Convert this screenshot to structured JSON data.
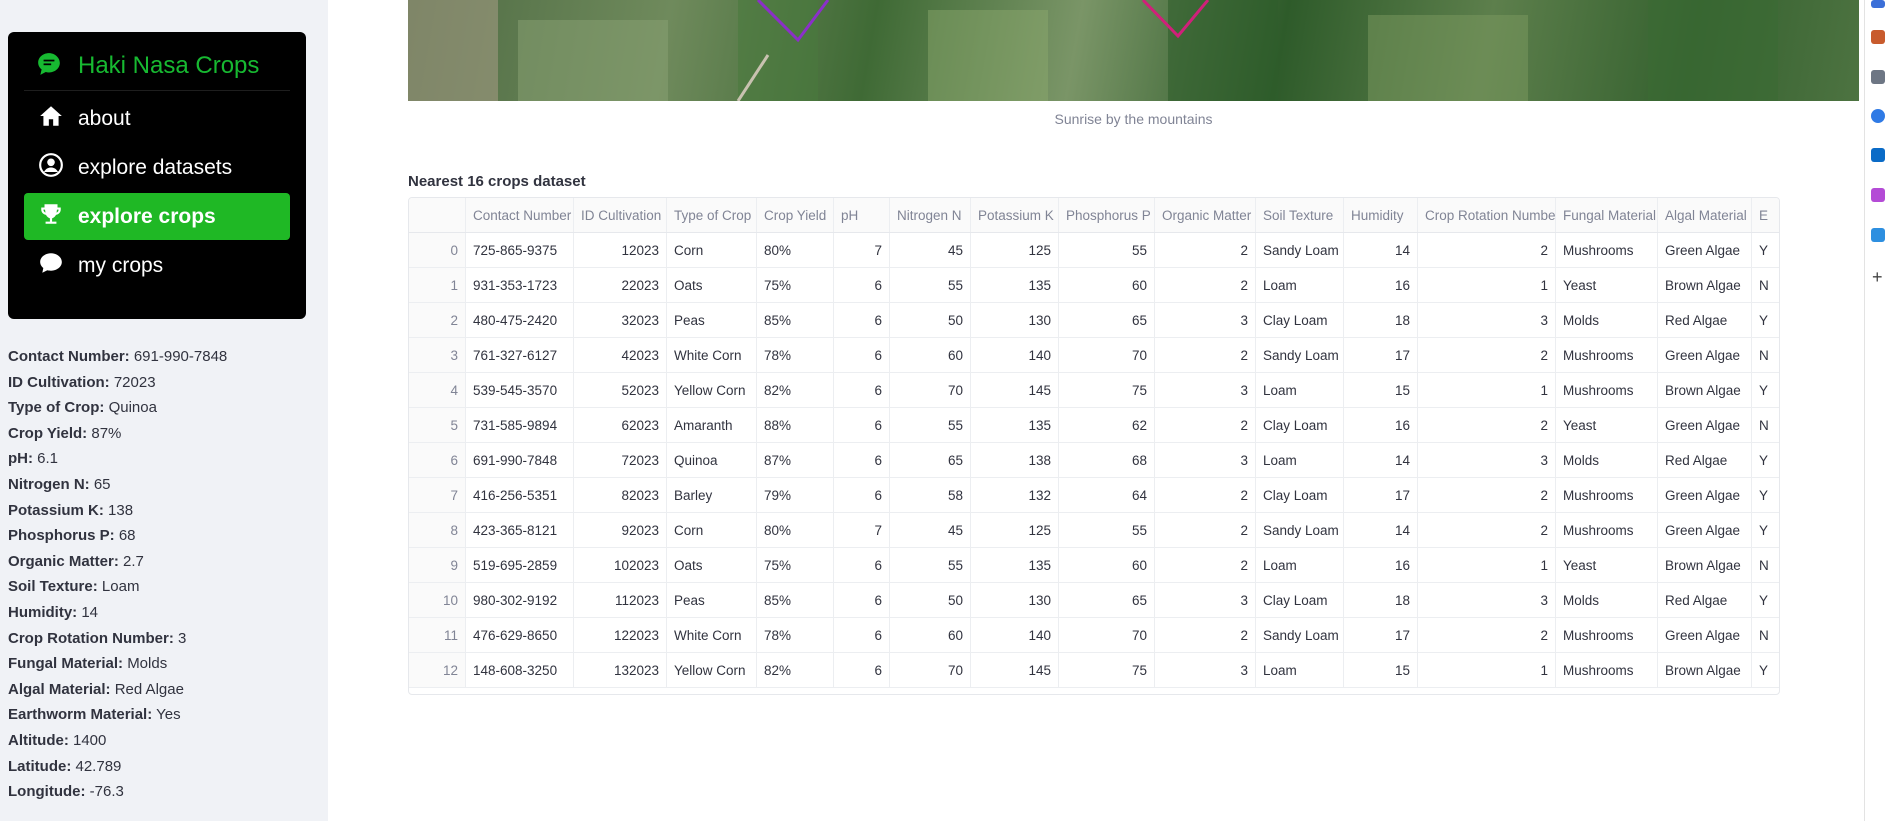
{
  "sidebar": {
    "brand": "Haki Nasa Crops",
    "menu": [
      {
        "label": "about",
        "icon": "house-icon",
        "active": false
      },
      {
        "label": "explore datasets",
        "icon": "person-circle-icon",
        "active": false
      },
      {
        "label": "explore crops",
        "icon": "trophy-icon",
        "active": true
      },
      {
        "label": "my crops",
        "icon": "chat-bubble-icon",
        "active": false
      }
    ],
    "details": [
      {
        "k": "Contact Number:",
        "v": "691-990-7848"
      },
      {
        "k": "ID Cultivation:",
        "v": "72023"
      },
      {
        "k": "Type of Crop:",
        "v": "Quinoa"
      },
      {
        "k": "Crop Yield:",
        "v": "87%"
      },
      {
        "k": "pH:",
        "v": "6.1"
      },
      {
        "k": "Nitrogen N:",
        "v": "65"
      },
      {
        "k": "Potassium K:",
        "v": "138"
      },
      {
        "k": "Phosphorus P:",
        "v": "68"
      },
      {
        "k": "Organic Matter:",
        "v": "2.7"
      },
      {
        "k": "Soil Texture:",
        "v": "Loam"
      },
      {
        "k": "Humidity:",
        "v": "14"
      },
      {
        "k": "Crop Rotation Number:",
        "v": "3"
      },
      {
        "k": "Fungal Material:",
        "v": "Molds"
      },
      {
        "k": "Algal Material:",
        "v": "Red Algae"
      },
      {
        "k": "Earthworm Material:",
        "v": "Yes"
      },
      {
        "k": "Altitude:",
        "v": "1400"
      },
      {
        "k": "Latitude:",
        "v": "42.789"
      },
      {
        "k": "Longitude:",
        "v": "-76.3"
      }
    ]
  },
  "main": {
    "image_caption": "Sunrise by the mountains",
    "table_title": "Nearest 16 crops dataset",
    "columns": [
      "",
      "Contact Number",
      "ID Cultivation",
      "Type of Crop",
      "Crop Yield",
      "pH",
      "Nitrogen N",
      "Potassium K",
      "Phosphorus P",
      "Organic Matter",
      "Soil Texture",
      "Humidity",
      "Crop Rotation Number",
      "Fungal Material",
      "Algal Material",
      "E"
    ],
    "rows": [
      [
        "0",
        "725-865-9375",
        "12023",
        "Corn",
        "80%",
        "7",
        "45",
        "125",
        "55",
        "2",
        "Sandy Loam",
        "14",
        "2",
        "Mushrooms",
        "Green Algae",
        "Y"
      ],
      [
        "1",
        "931-353-1723",
        "22023",
        "Oats",
        "75%",
        "6",
        "55",
        "135",
        "60",
        "2",
        "Loam",
        "16",
        "1",
        "Yeast",
        "Brown Algae",
        "N"
      ],
      [
        "2",
        "480-475-2420",
        "32023",
        "Peas",
        "85%",
        "6",
        "50",
        "130",
        "65",
        "3",
        "Clay Loam",
        "18",
        "3",
        "Molds",
        "Red Algae",
        "Y"
      ],
      [
        "3",
        "761-327-6127",
        "42023",
        "White Corn",
        "78%",
        "6",
        "60",
        "140",
        "70",
        "2",
        "Sandy Loam",
        "17",
        "2",
        "Mushrooms",
        "Green Algae",
        "N"
      ],
      [
        "4",
        "539-545-3570",
        "52023",
        "Yellow Corn",
        "82%",
        "6",
        "70",
        "145",
        "75",
        "3",
        "Loam",
        "15",
        "1",
        "Mushrooms",
        "Brown Algae",
        "Y"
      ],
      [
        "5",
        "731-585-9894",
        "62023",
        "Amaranth",
        "88%",
        "6",
        "55",
        "135",
        "62",
        "2",
        "Clay Loam",
        "16",
        "2",
        "Yeast",
        "Green Algae",
        "N"
      ],
      [
        "6",
        "691-990-7848",
        "72023",
        "Quinoa",
        "87%",
        "6",
        "65",
        "138",
        "68",
        "3",
        "Loam",
        "14",
        "3",
        "Molds",
        "Red Algae",
        "Y"
      ],
      [
        "7",
        "416-256-5351",
        "82023",
        "Barley",
        "79%",
        "6",
        "58",
        "132",
        "64",
        "2",
        "Clay Loam",
        "17",
        "2",
        "Mushrooms",
        "Green Algae",
        "Y"
      ],
      [
        "8",
        "423-365-8121",
        "92023",
        "Corn",
        "80%",
        "7",
        "45",
        "125",
        "55",
        "2",
        "Sandy Loam",
        "14",
        "2",
        "Mushrooms",
        "Green Algae",
        "Y"
      ],
      [
        "9",
        "519-695-2859",
        "102023",
        "Oats",
        "75%",
        "6",
        "55",
        "135",
        "60",
        "2",
        "Loam",
        "16",
        "1",
        "Yeast",
        "Brown Algae",
        "N"
      ],
      [
        "10",
        "980-302-9192",
        "112023",
        "Peas",
        "85%",
        "6",
        "50",
        "130",
        "65",
        "3",
        "Clay Loam",
        "18",
        "3",
        "Molds",
        "Red Algae",
        "Y"
      ],
      [
        "11",
        "476-629-8650",
        "122023",
        "White Corn",
        "78%",
        "6",
        "60",
        "140",
        "70",
        "2",
        "Sandy Loam",
        "17",
        "2",
        "Mushrooms",
        "Green Algae",
        "N"
      ],
      [
        "12",
        "148-608-3250",
        "132023",
        "Yellow Corn",
        "82%",
        "6",
        "70",
        "145",
        "75",
        "3",
        "Loam",
        "15",
        "1",
        "Mushrooms",
        "Brown Algae",
        "Y"
      ]
    ]
  },
  "colors": {
    "brand_green": "#17b931",
    "active_bg": "#1fb825",
    "menu_bg": "#000000",
    "sidebar_bg": "#f0f2f6"
  }
}
